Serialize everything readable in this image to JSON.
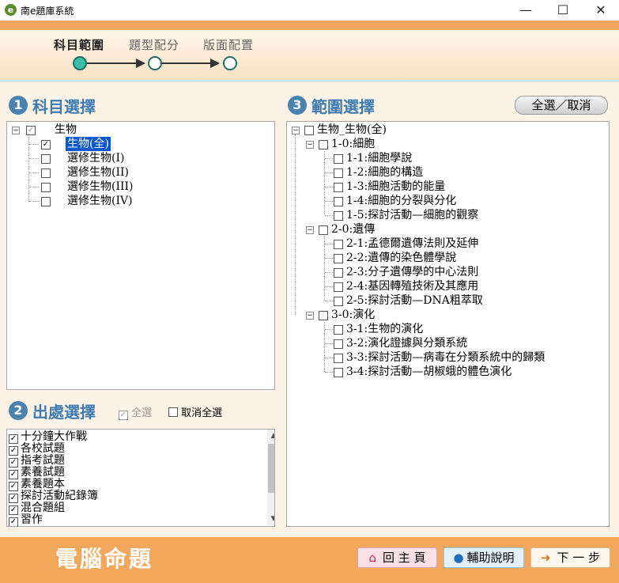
{
  "window": {
    "title": "南e題庫系統",
    "logo_letter": "e",
    "min": "—",
    "max": "☐",
    "close": "✕"
  },
  "steps": [
    {
      "label": "科目範圍",
      "active": true
    },
    {
      "label": "題型配分",
      "active": false
    },
    {
      "label": "版面配置",
      "active": false
    }
  ],
  "section1": {
    "num": "1",
    "title": "科目選擇"
  },
  "section2": {
    "num": "2",
    "title": "出處選擇",
    "check_all": "全選",
    "uncheck_all": "取消全選"
  },
  "section3": {
    "num": "3",
    "title": "範圍選擇",
    "toggle_all": "全選／取消"
  },
  "subject_tree": {
    "root": "生物",
    "items": [
      "生物(全)",
      "選修生物(I)",
      "選修生物(II)",
      "選修生物(III)",
      "選修生物(IV)"
    ]
  },
  "sources": [
    "十分鐘大作戰",
    "各校試題",
    "指考試題",
    "素養試題",
    "素養題本",
    "探討活動紀錄簿",
    "混合題組",
    "習作"
  ],
  "range_tree": {
    "root": "生物_生物(全)",
    "chapters": [
      {
        "label": "1-0:細胞",
        "sections": [
          "1-1:細胞學說",
          "1-2:細胞的構造",
          "1-3:細胞活動的能量",
          "1-4:細胞的分裂與分化",
          "1-5:探討活動—細胞的觀察"
        ]
      },
      {
        "label": "2-0:遺傳",
        "sections": [
          "2-1:孟德爾遺傳法則及延伸",
          "2-2:遺傳的染色體學說",
          "2-3:分子遺傳學的中心法則",
          "2-4:基因轉殖技術及其應用",
          "2-5:探討活動—DNA粗萃取"
        ]
      },
      {
        "label": "3-0:演化",
        "sections": [
          "3-1:生物的演化",
          "3-2:演化證據與分類系統",
          "3-3:探討活動—病毒在分類系統中的歸類",
          "3-4:探討活動—胡椒蛾的體色演化"
        ]
      }
    ]
  },
  "footer": {
    "title": "電腦命題",
    "home": "回 主 頁",
    "help": "輔助說明",
    "next": "下 一 步"
  },
  "colors": {
    "accent": "#f1a85c",
    "title_blue": "#3e7cb0",
    "step_dot_active": "#39c0a6"
  }
}
